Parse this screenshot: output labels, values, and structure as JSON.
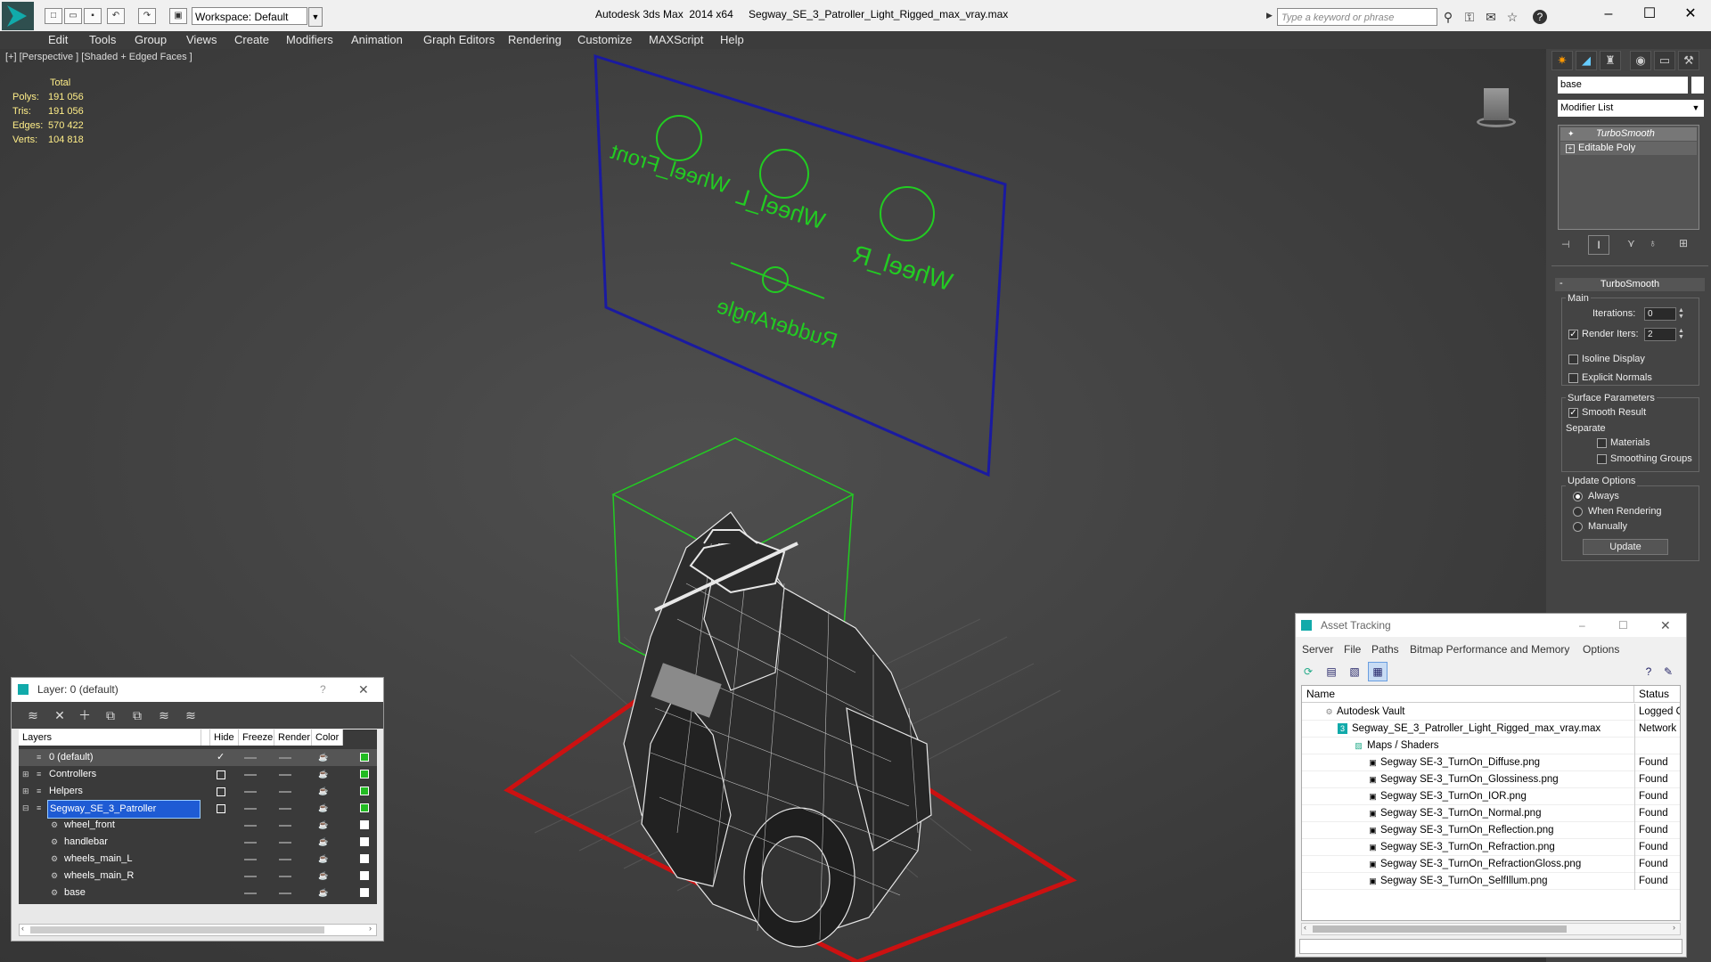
{
  "titlebar": {
    "app_title": "Autodesk 3ds Max  2014 x64",
    "file_title": "Segway_SE_3_Patroller_Light_Rigged_max_vray.max",
    "workspace": "Workspace: Default",
    "search_placeholder": "Type a keyword or phrase"
  },
  "menubar": [
    "Edit",
    "Tools",
    "Group",
    "Views",
    "Create",
    "Modifiers",
    "Animation",
    "Graph Editors",
    "Rendering",
    "Customize",
    "MAXScript",
    "Help"
  ],
  "viewport": {
    "label": "[+] [Perspective ] [Shaded + Edged Faces ]",
    "stats": {
      "header": "Total",
      "rows": [
        {
          "k": "Polys:",
          "v": "191 056"
        },
        {
          "k": "Tris:",
          "v": "191 056"
        },
        {
          "k": "Edges:",
          "v": "570 422"
        },
        {
          "k": "Verts:",
          "v": "104 818"
        }
      ]
    },
    "rig_labels": {
      "front": "Wheel_Front",
      "left": "Wheel_L",
      "right": "Wheel_R",
      "rudder": "RudderAngle"
    },
    "colors": {
      "panel_frame": "#1a1aa0",
      "controls": "#22cc22",
      "grid": "#cc1111"
    }
  },
  "command_panel": {
    "name_field": "base",
    "modifier_list": "Modifier List",
    "stack": [
      "TurboSmooth",
      "Editable Poly"
    ],
    "rollout": {
      "title": "TurboSmooth",
      "main_label": "Main",
      "iterations_label": "Iterations:",
      "iterations_value": "0",
      "render_iters_label": "Render Iters:",
      "render_iters_value": "2",
      "isoline_label": "Isoline Display",
      "explicit_label": "Explicit Normals",
      "surface_label": "Surface Parameters",
      "smooth_result_label": "Smooth Result",
      "separate_label": "Separate",
      "materials_label": "Materials",
      "smoothing_label": "Smoothing Groups",
      "update_label": "Update Options",
      "always_label": "Always",
      "when_rendering_label": "When Rendering",
      "manually_label": "Manually",
      "update_button": "Update"
    }
  },
  "layer_dialog": {
    "title": "Layer: 0 (default)",
    "help": "?",
    "columns": [
      "Layers",
      "Hide",
      "Freeze",
      "Render",
      "Color"
    ],
    "rows": [
      {
        "name": "0 (default)",
        "current": true,
        "color": "#22bb22"
      },
      {
        "name": "Controllers",
        "current": false,
        "color": "#22bb22"
      },
      {
        "name": "Helpers",
        "current": false,
        "color": "#22bb22"
      },
      {
        "name": "Segway_SE_3_Patroller",
        "current": false,
        "color": "#22bb22"
      },
      {
        "name": "wheel_front",
        "current": false,
        "color": "#ffffff"
      },
      {
        "name": "handlebar",
        "current": false,
        "color": "#ffffff"
      },
      {
        "name": "wheels_main_L",
        "current": false,
        "color": "#ffffff"
      },
      {
        "name": "wheels_main_R",
        "current": false,
        "color": "#ffffff"
      },
      {
        "name": "base",
        "current": false,
        "color": "#ffffff"
      }
    ]
  },
  "asset_dialog": {
    "title": "Asset Tracking",
    "menus": [
      "Server",
      "File",
      "Paths",
      "Bitmap Performance and Memory",
      "Options"
    ],
    "columns": [
      "Name",
      "Status"
    ],
    "rows": [
      {
        "name": "Autodesk Vault",
        "status": "Logged O"
      },
      {
        "name": "Segway_SE_3_Patroller_Light_Rigged_max_vray.max",
        "status": "Network I"
      },
      {
        "name": "Maps / Shaders",
        "status": ""
      },
      {
        "name": "Segway SE-3_TurnOn_Diffuse.png",
        "status": "Found"
      },
      {
        "name": "Segway SE-3_TurnOn_Glossiness.png",
        "status": "Found"
      },
      {
        "name": "Segway SE-3_TurnOn_IOR.png",
        "status": "Found"
      },
      {
        "name": "Segway SE-3_TurnOn_Normal.png",
        "status": "Found"
      },
      {
        "name": "Segway SE-3_TurnOn_Reflection.png",
        "status": "Found"
      },
      {
        "name": "Segway SE-3_TurnOn_Refraction.png",
        "status": "Found"
      },
      {
        "name": "Segway SE-3_TurnOn_RefractionGloss.png",
        "status": "Found"
      },
      {
        "name": "Segway SE-3_TurnOn_SelfIllum.png",
        "status": "Found"
      }
    ]
  }
}
